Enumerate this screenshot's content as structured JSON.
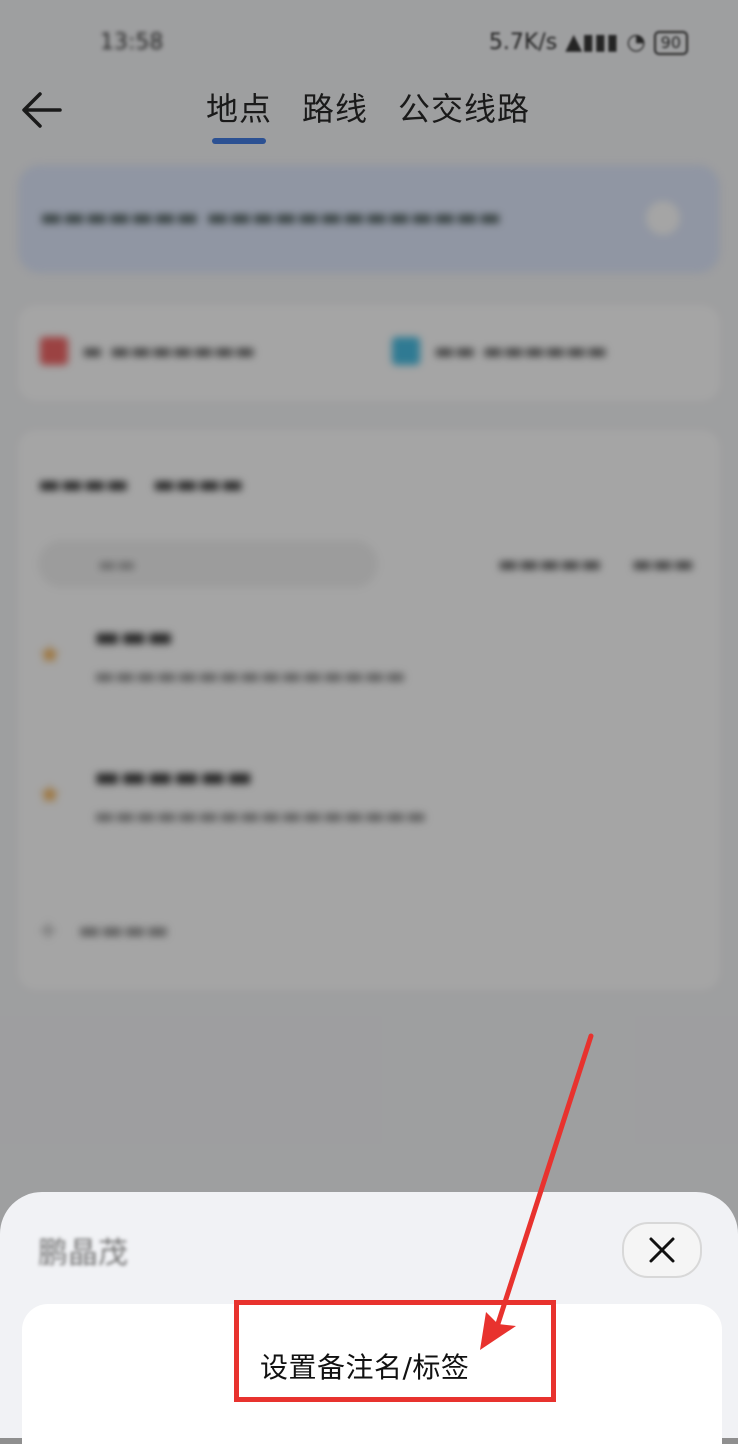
{
  "status_bar": {
    "time": "13:58",
    "network_speed": "5.7K/s",
    "battery": "90"
  },
  "nav": {
    "tabs": [
      {
        "label": "地点",
        "active": true
      },
      {
        "label": "路线",
        "active": false
      },
      {
        "label": "公交线路",
        "active": false
      }
    ]
  },
  "bottom_sheet": {
    "title": "鹏晶茂",
    "option_label": "设置备注名/标签"
  },
  "colors": {
    "accent": "#2f6fe0",
    "annotation": "#e8322e"
  }
}
